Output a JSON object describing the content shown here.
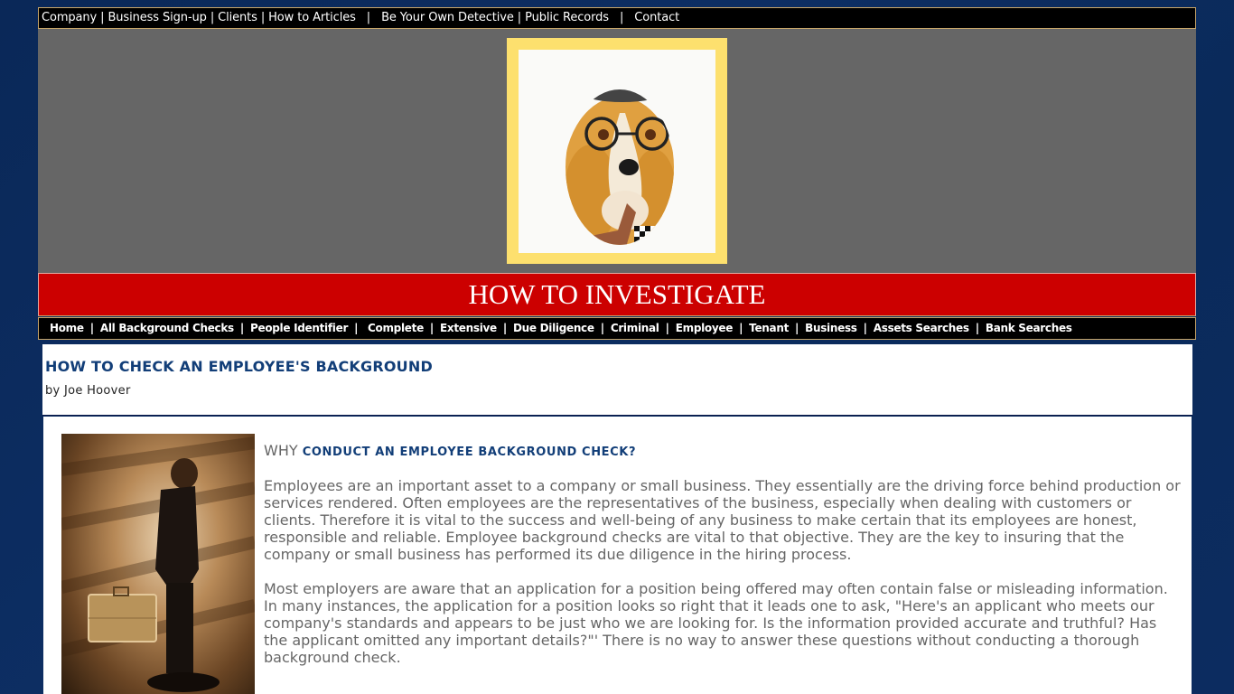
{
  "top_nav": {
    "items": [
      "Company",
      "Business Sign-up",
      "Clients",
      "How to Articles",
      "Be Your Own Detective",
      "Public Records",
      "Contact"
    ]
  },
  "banner": {
    "logo_alt": "Detective basset hound with glasses, cap and pipe",
    "title": "HOW TO INVESTIGATE"
  },
  "main_nav": {
    "items": [
      "Home",
      "All Background Checks",
      "People Identifier",
      "Complete",
      "Extensive",
      "Due Diligence",
      "Criminal",
      "Employee",
      "Tenant",
      "Business",
      "Assets Searches",
      "Bank Searches"
    ]
  },
  "article": {
    "title": "HOW TO CHECK AN EMPLOYEE'S BACKGROUND",
    "byline": "by Joe Hoover",
    "photo_alt": "Man in suit holding a briefcase",
    "section_prefix": "WHY",
    "section_heading": "CONDUCT AN EMPLOYEE BACKGROUND CHECK?",
    "paragraphs": [
      "Employees are an important asset to a company or small business. They essentially are the driving force behind production or services rendered. Often employees are the representatives of the business, especially when dealing with customers or clients. Therefore it is vital to the success and well-being of any business to make certain that its employees are honest, responsible and reliable. Employee background checks are vital to that objective. They are the key to insuring that the company or small business has performed its due diligence in the hiring process.",
      "Most employers are aware that an application for a position being offered may often contain false or misleading information. In many instances, the application for a position looks so right that it leads one to ask, \"Here's an applicant who meets our company's standards and appears to be just who we are looking for. Is the information provided accurate and truthful? Has the applicant omitted any important details?\"' There is no way to answer these questions without conducting a thorough background check."
    ]
  },
  "colors": {
    "page_bg": "#0b2a5c",
    "nav_bg": "#000000",
    "nav_border": "#c8a66a",
    "banner_bg": "#666666",
    "title_bar": "#cc0000",
    "logo_frame": "#fde06e",
    "heading": "#123e78",
    "body_text": "#666666"
  }
}
